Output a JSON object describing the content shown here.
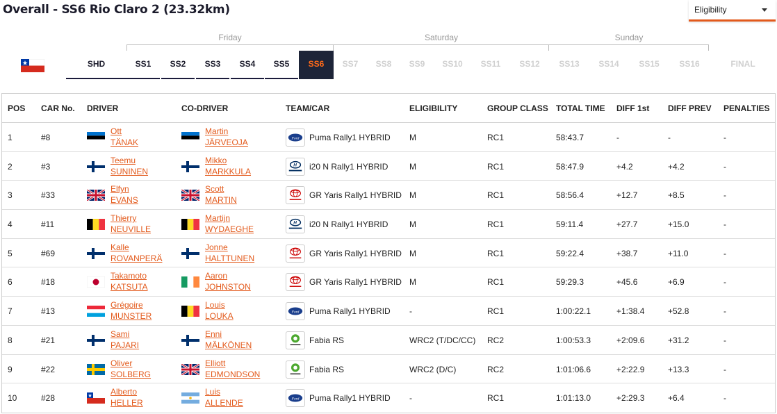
{
  "page_title": "Overall - SS6 Rio Claro 2 (23.32km)",
  "eligibility": {
    "label": "Eligibility"
  },
  "days": [
    "Friday",
    "Saturday",
    "Sunday"
  ],
  "tabs": {
    "shd": "SHD",
    "stages": [
      "SS1",
      "SS2",
      "SS3",
      "SS4",
      "SS5",
      "SS6",
      "SS7",
      "SS8",
      "SS9",
      "SS10",
      "SS11",
      "SS12",
      "SS13",
      "SS14",
      "SS15",
      "SS16"
    ],
    "final": "FINAL",
    "active": "SS6"
  },
  "columns": [
    "POS",
    "CAR No.",
    "DRIVER",
    "CO-DRIVER",
    "TEAM/CAR",
    "ELIGIBILITY",
    "GROUP CLASS",
    "TOTAL TIME",
    "DIFF 1st",
    "DIFF PREV",
    "PENALTIES"
  ],
  "rows": [
    {
      "pos": "1",
      "car": "#8",
      "driver_first": "Ott",
      "driver_last": "TÄNAK",
      "driver_flag": "estonia",
      "codriver_first": "Martin",
      "codriver_last": "JÄRVEOJA",
      "codriver_flag": "estonia",
      "logo": "ford-logo",
      "team": "Puma Rally1 HYBRID",
      "elig": "M",
      "group": "RC1",
      "time": "58:43.7",
      "diff1": "-",
      "diffp": "-",
      "pen": "-"
    },
    {
      "pos": "2",
      "car": "#3",
      "driver_first": "Teemu",
      "driver_last": "SUNINEN",
      "driver_flag": "finland",
      "codriver_first": "Mikko",
      "codriver_last": "MARKKULA",
      "codriver_flag": "finland",
      "logo": "hyundai-logo",
      "team": "i20 N Rally1 HYBRID",
      "elig": "M",
      "group": "RC1",
      "time": "58:47.9",
      "diff1": "+4.2",
      "diffp": "+4.2",
      "pen": "-"
    },
    {
      "pos": "3",
      "car": "#33",
      "driver_first": "Elfyn",
      "driver_last": "EVANS",
      "driver_flag": "uk",
      "codriver_first": "Scott",
      "codriver_last": "MARTIN",
      "codriver_flag": "uk",
      "logo": "toyota-logo",
      "team": "GR Yaris Rally1 HYBRID",
      "elig": "M",
      "group": "RC1",
      "time": "58:56.4",
      "diff1": "+12.7",
      "diffp": "+8.5",
      "pen": "-"
    },
    {
      "pos": "4",
      "car": "#11",
      "driver_first": "Thierry",
      "driver_last": "NEUVILLE",
      "driver_flag": "belgium",
      "codriver_first": "Martijn",
      "codriver_last": "WYDAEGHE",
      "codriver_flag": "belgium",
      "logo": "hyundai-logo",
      "team": "i20 N Rally1 HYBRID",
      "elig": "M",
      "group": "RC1",
      "time": "59:11.4",
      "diff1": "+27.7",
      "diffp": "+15.0",
      "pen": "-"
    },
    {
      "pos": "5",
      "car": "#69",
      "driver_first": "Kalle",
      "driver_last": "ROVANPERÄ",
      "driver_flag": "finland",
      "codriver_first": "Jonne",
      "codriver_last": "HALTTUNEN",
      "codriver_flag": "finland",
      "logo": "toyota-logo",
      "team": "GR Yaris Rally1 HYBRID",
      "elig": "M",
      "group": "RC1",
      "time": "59:22.4",
      "diff1": "+38.7",
      "diffp": "+11.0",
      "pen": "-"
    },
    {
      "pos": "6",
      "car": "#18",
      "driver_first": "Takamoto",
      "driver_last": "KATSUTA",
      "driver_flag": "japan",
      "codriver_first": "Aaron",
      "codriver_last": "JOHNSTON",
      "codriver_flag": "ireland",
      "logo": "toyota-logo",
      "team": "GR Yaris Rally1 HYBRID",
      "elig": "M",
      "group": "RC1",
      "time": "59:29.3",
      "diff1": "+45.6",
      "diffp": "+6.9",
      "pen": "-"
    },
    {
      "pos": "7",
      "car": "#13",
      "driver_first": "Grégoire",
      "driver_last": "MUNSTER",
      "driver_flag": "luxembourg",
      "codriver_first": "Louis",
      "codriver_last": "LOUKA",
      "codriver_flag": "belgium",
      "logo": "ford-logo",
      "team": "Puma Rally1 HYBRID",
      "elig": "-",
      "group": "RC1",
      "time": "1:00:22.1",
      "diff1": "+1:38.4",
      "diffp": "+52.8",
      "pen": "-"
    },
    {
      "pos": "8",
      "car": "#21",
      "driver_first": "Sami",
      "driver_last": "PAJARI",
      "driver_flag": "finland",
      "codriver_first": "Enni",
      "codriver_last": "MÄLKÖNEN",
      "codriver_flag": "finland",
      "logo": "skoda-logo",
      "team": "Fabia RS",
      "elig": "WRC2 (T/DC/CC)",
      "group": "RC2",
      "time": "1:00:53.3",
      "diff1": "+2:09.6",
      "diffp": "+31.2",
      "pen": "-"
    },
    {
      "pos": "9",
      "car": "#22",
      "driver_first": "Oliver",
      "driver_last": "SOLBERG",
      "driver_flag": "sweden",
      "codriver_first": "Elliott",
      "codriver_last": "EDMONDSON",
      "codriver_flag": "uk",
      "logo": "skoda-logo",
      "team": "Fabia RS",
      "elig": "WRC2 (D/C)",
      "group": "RC2",
      "time": "1:01:06.6",
      "diff1": "+2:22.9",
      "diffp": "+13.3",
      "pen": "-"
    },
    {
      "pos": "10",
      "car": "#28",
      "driver_first": "Alberto",
      "driver_last": "HELLER",
      "driver_flag": "chile",
      "codriver_first": "Luis",
      "codriver_last": "ALLENDE",
      "codriver_flag": "argentina",
      "logo": "ford-logo",
      "team": "Puma Rally1 HYBRID",
      "elig": "-",
      "group": "RC1",
      "time": "1:01:13.0",
      "diff1": "+2:29.3",
      "diffp": "+6.4",
      "pen": "-"
    }
  ]
}
